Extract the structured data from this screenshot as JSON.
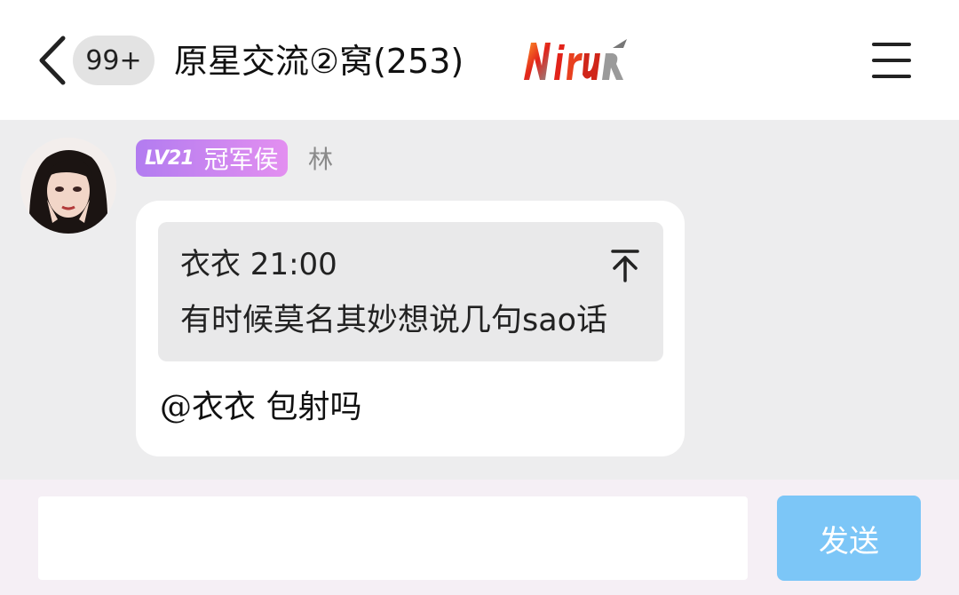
{
  "header": {
    "back_icon": "chevron-left-icon",
    "unread_badge": "99+",
    "title": "原星交流②窝(253)",
    "logo_icon": "fire-logo-icon",
    "menu_icon": "hamburger-menu-icon"
  },
  "message": {
    "level_badge": "LV21",
    "title_badge": "冠军侯",
    "sender": "林",
    "level_badge_colors": [
      "#b27cf0",
      "#e38ff0"
    ],
    "quote": {
      "author_time": "衣衣 21:00",
      "jump_icon": "jump-to-top-icon",
      "text": "有时候莫名其妙想说几句sao话"
    },
    "reply": "@衣衣 包射吗"
  },
  "composer": {
    "input_value": "",
    "send_label": "发送",
    "send_color": "#7cc6f7"
  }
}
